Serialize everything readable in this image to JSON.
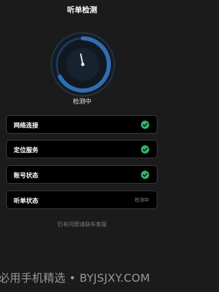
{
  "header": {
    "title": "听单检测"
  },
  "gauge": {
    "status": "检测中",
    "colors": {
      "arc": "#2f6fb2",
      "ring": "#1f4b78",
      "needle": "#dfe6ee"
    }
  },
  "checks": [
    {
      "label": "网络连接",
      "state": "ok",
      "icon": "check-icon"
    },
    {
      "label": "定位服务",
      "state": "ok",
      "icon": "check-icon"
    },
    {
      "label": "账号状态",
      "state": "ok",
      "icon": "check-icon"
    },
    {
      "label": "听单状态",
      "state_text": "检测中"
    }
  ],
  "footer": {
    "help": "仍有问题请联系客服"
  },
  "watermark": {
    "text": "必用手机精选 • BYJSJXY.COM"
  },
  "colors": {
    "success": "#34b36a",
    "background": "#1b1b1b",
    "card": "#000000"
  }
}
